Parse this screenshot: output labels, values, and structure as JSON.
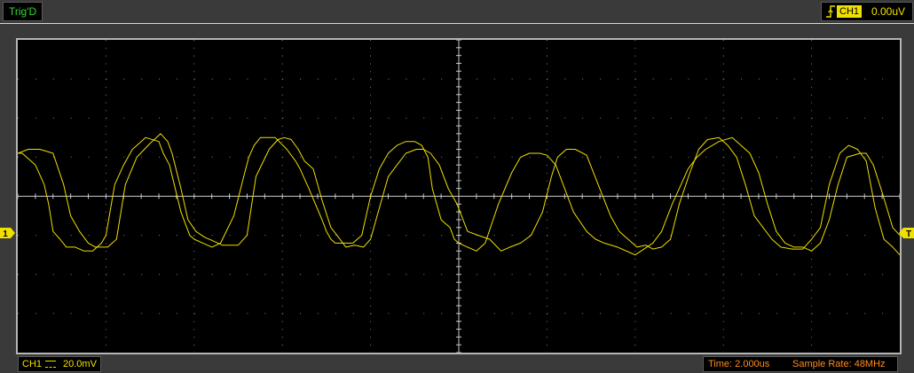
{
  "header": {
    "trigger_status": "Trig'D",
    "trigger_channel": "CH1",
    "trigger_level": "0.00uV",
    "trigger_edge_icon": "rising-edge-icon"
  },
  "screen": {
    "divisions_x": 10,
    "divisions_y": 8,
    "background": "#000000",
    "grid_color": "#808080",
    "trace_color": "#f0e000"
  },
  "markers": {
    "channel_marker_label": "1",
    "trigger_marker_label": "T",
    "marker_color": "#f0e000"
  },
  "footer": {
    "ch1_label": "CH1",
    "ch1_scale": "20.0mV",
    "coupling_icon": "dc-coupling-icon",
    "timebase": "Time: 2.000us",
    "sample_rate": "Sample Rate: 48MHz",
    "time_color": "#ff8a1c"
  },
  "chart_data": {
    "type": "line",
    "title": "",
    "xlabel": "",
    "ylabel": "",
    "grid": true,
    "xlim": [
      0,
      10
    ],
    "ylim": [
      -4,
      4
    ],
    "x_units": "divisions",
    "y_units": "divisions",
    "series": [
      {
        "x": [
          0,
          0.05,
          0.15,
          0.2,
          0.3,
          0.35,
          0.4,
          0.48,
          0.55,
          0.65,
          0.7,
          0.75,
          0.85,
          0.95,
          1.0,
          1.1,
          1.2,
          1.25,
          1.3,
          1.4,
          1.45,
          1.6,
          1.65,
          1.72,
          1.85,
          1.95,
          2.0,
          2.1,
          2.2,
          2.3,
          2.45,
          2.55,
          2.62,
          2.68,
          2.75,
          2.8,
          2.92,
          3.05,
          3.15,
          3.2,
          3.3,
          3.45,
          3.5,
          3.55,
          3.6,
          3.65,
          3.8,
          3.9,
          4.0,
          4.1,
          4.2,
          4.3,
          4.4,
          4.5,
          4.58,
          4.65,
          4.7,
          4.8,
          4.9,
          4.95,
          5.0,
          5.1,
          5.2,
          5.3,
          5.45,
          5.6,
          5.7,
          5.8,
          5.92,
          6.0,
          6.1,
          6.2,
          6.3,
          6.45,
          6.55,
          6.65,
          6.8,
          6.95,
          7.0,
          7.1,
          7.2,
          7.3,
          7.42,
          7.52,
          7.6,
          7.7,
          7.8,
          7.95,
          8.1,
          8.2,
          8.3,
          8.4,
          8.5,
          8.6,
          8.7,
          8.8,
          8.9,
          9.0,
          9.1,
          9.2,
          9.3,
          9.4,
          9.55,
          9.62,
          9.7,
          9.8,
          9.92,
          10.0
        ],
        "y": [
          1.1,
          1.1,
          0.9,
          0.8,
          0.3,
          -0.2,
          -0.9,
          -1.1,
          -1.3,
          -1.3,
          -1.35,
          -1.4,
          -1.4,
          -1.2,
          -1.0,
          0.3,
          0.8,
          1.0,
          1.2,
          1.4,
          1.5,
          1.4,
          1.1,
          0.8,
          -0.4,
          -1.0,
          -1.1,
          -1.2,
          -1.3,
          -1.2,
          -0.5,
          0.4,
          1.0,
          1.3,
          1.5,
          1.5,
          1.5,
          1.2,
          0.9,
          0.7,
          0.2,
          -0.6,
          -0.9,
          -1.1,
          -1.2,
          -1.2,
          -1.2,
          -1.0,
          0.0,
          0.7,
          1.1,
          1.3,
          1.4,
          1.4,
          1.3,
          1.0,
          0.2,
          -0.6,
          -0.8,
          -1.1,
          -1.2,
          -1.3,
          -1.4,
          -1.2,
          -0.2,
          0.6,
          1.0,
          1.1,
          1.1,
          1.05,
          0.8,
          0.2,
          -0.4,
          -0.9,
          -1.1,
          -1.2,
          -1.3,
          -1.45,
          -1.5,
          -1.35,
          -1.2,
          -0.9,
          -0.2,
          0.3,
          0.7,
          1.0,
          1.2,
          1.4,
          1.5,
          1.3,
          1.1,
          0.6,
          -0.2,
          -0.9,
          -1.2,
          -1.3,
          -1.3,
          -1.4,
          -1.2,
          -0.6,
          0.3,
          1.0,
          1.1,
          1.1,
          0.8,
          0.1,
          -0.8,
          -1.0
        ]
      },
      {
        "x": [
          0,
          0.12,
          0.25,
          0.4,
          0.52,
          0.6,
          0.7,
          0.8,
          0.88,
          0.95,
          1.02,
          1.12,
          1.22,
          1.35,
          1.5,
          1.62,
          1.7,
          1.75,
          1.85,
          1.93,
          2.02,
          2.12,
          2.22,
          2.32,
          2.5,
          2.6,
          2.7,
          2.85,
          2.95,
          3.02,
          3.1,
          3.18,
          3.25,
          3.35,
          3.45,
          3.55,
          3.62,
          3.72,
          3.82,
          3.92,
          4.0,
          4.1,
          4.2,
          4.3,
          4.4,
          4.52,
          4.6,
          4.68,
          4.78,
          4.88,
          4.98,
          5.1,
          5.22,
          5.35,
          5.48,
          5.58,
          5.7,
          5.82,
          5.95,
          6.05,
          6.12,
          6.22,
          6.32,
          6.45,
          6.58,
          6.72,
          6.82,
          6.92,
          7.02,
          7.12,
          7.2,
          7.3,
          7.4,
          7.5,
          7.62,
          7.72,
          7.82,
          7.95,
          8.05,
          8.15,
          8.25,
          8.35,
          8.45,
          8.55,
          8.65,
          8.78,
          8.9,
          9.0,
          9.1,
          9.2,
          9.32,
          9.42,
          9.52,
          9.62,
          9.72,
          9.82,
          9.92,
          10.0
        ],
        "y": [
          1.1,
          1.2,
          1.2,
          1.1,
          0.3,
          -0.5,
          -0.9,
          -1.2,
          -1.3,
          -1.3,
          -1.3,
          -1.1,
          0.3,
          1.0,
          1.35,
          1.6,
          1.4,
          1.1,
          0.2,
          -0.6,
          -0.9,
          -1.05,
          -1.15,
          -1.25,
          -1.25,
          -1.0,
          0.5,
          1.2,
          1.45,
          1.5,
          1.45,
          1.2,
          0.9,
          0.7,
          -0.1,
          -0.8,
          -1.0,
          -1.3,
          -1.25,
          -1.3,
          -1.1,
          -0.3,
          0.5,
          0.8,
          1.1,
          1.2,
          1.2,
          1.1,
          0.8,
          0.2,
          -0.2,
          -0.9,
          -1.0,
          -1.1,
          -1.4,
          -1.3,
          -1.2,
          -1.0,
          -0.4,
          0.5,
          1.0,
          1.2,
          1.2,
          1.05,
          0.3,
          -0.5,
          -0.9,
          -1.1,
          -1.3,
          -1.25,
          -1.35,
          -1.3,
          -1.1,
          -0.2,
          0.6,
          1.2,
          1.45,
          1.5,
          1.3,
          1.0,
          0.3,
          -0.5,
          -0.8,
          -1.1,
          -1.3,
          -1.35,
          -1.35,
          -1.1,
          -0.8,
          0.3,
          1.1,
          1.3,
          1.2,
          0.9,
          -0.3,
          -1.1,
          -1.3,
          -1.5
        ]
      }
    ]
  }
}
